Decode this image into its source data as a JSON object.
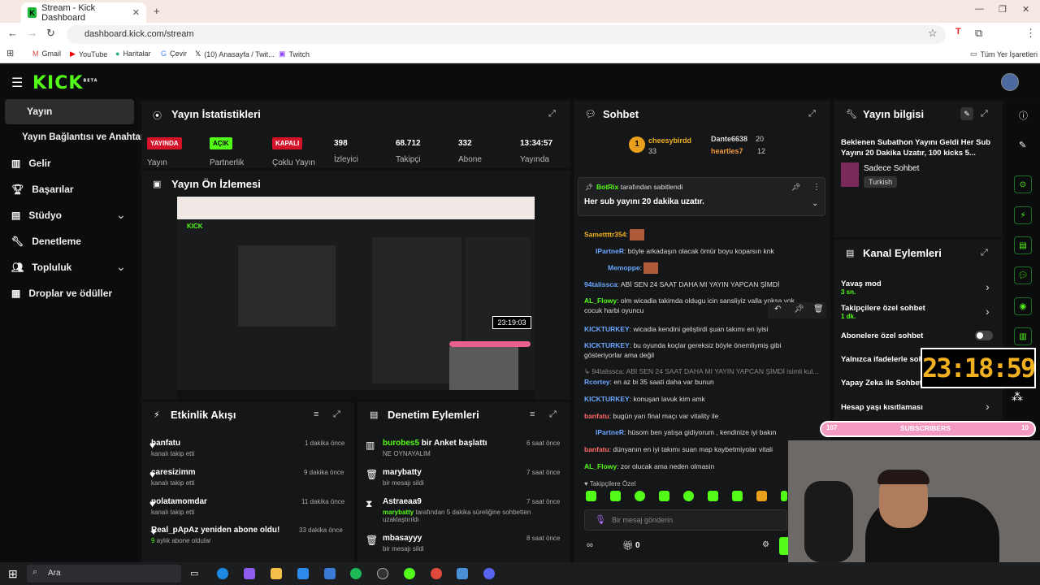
{
  "browser": {
    "tab_title": "Stream - Kick Dashboard",
    "url": "dashboard.kick.com/stream",
    "bookmarks": [
      "Gmail",
      "YouTube",
      "Haritalar",
      "Çevir",
      "(10) Anasayfa / Twit...",
      "Twitch"
    ],
    "all_bookmarks": "Tüm Yer İşaretleri"
  },
  "kick": {
    "logo": "KICK",
    "beta": "BETA"
  },
  "sidebar": {
    "items": [
      {
        "label": "Yayın"
      },
      {
        "label": "Yayın Bağlantısı ve Anahtarı"
      },
      {
        "label": "Gelir"
      },
      {
        "label": "Başarılar"
      },
      {
        "label": "Stüdyo"
      },
      {
        "label": "Denetleme"
      },
      {
        "label": "Topluluk"
      },
      {
        "label": "Droplar ve ödüller"
      }
    ]
  },
  "stats": {
    "title": "Yayın İstatistikleri",
    "live_badge": "YAYINDA",
    "live_label": "Yayın",
    "partner_badge": "AÇIK",
    "partner_label": "Partnerlik",
    "multi_badge": "KAPALI",
    "multi_label": "Çoklu Yayın",
    "viewers": "398",
    "viewers_label": "İzleyici",
    "followers": "68.712",
    "followers_label": "Takipçi",
    "subs": "332",
    "subs_label": "Abone",
    "uptime": "13:34:57",
    "uptime_label": "Yayında"
  },
  "preview": {
    "title": "Yayın Ön İzlemesi",
    "timer": "23:19:03"
  },
  "activity": {
    "title": "Etkinlik Akışı",
    "items": [
      {
        "name": "banfatu",
        "sub": "kanalı takip etti",
        "time": "1 dakika önce"
      },
      {
        "name": "caresizimm",
        "sub": "kanalı takip etti",
        "time": "9 dakika önce"
      },
      {
        "name": "polatamomdar",
        "sub": "kanalı takip etti",
        "time": "11 dakika önce"
      },
      {
        "name": "Real_pApAz yeniden abone oldu!",
        "sub_num": "9",
        "sub": " aylık abone oldular",
        "time": "33 dakika önce"
      }
    ]
  },
  "moderation": {
    "title": "Denetim Eylemleri",
    "items": [
      {
        "name": "burobes5",
        "action": " bir Anket başlattı",
        "sub": "NE OYNAYALIM",
        "time": "6 saat önce"
      },
      {
        "name": "marybatty",
        "sub": "bir mesajı sildi",
        "time": "7 saat önce"
      },
      {
        "name": "Astraeaa9",
        "sub_user": "marybatty",
        "sub": " tarafından 5 dakika süreliğine sohbetten uzaklaştırıldı",
        "time": "7 saat önce"
      },
      {
        "name": "mbasayyy",
        "sub": "bir mesajı sildi",
        "time": "8 saat önce"
      }
    ]
  },
  "chat": {
    "title": "Sohbet",
    "top": [
      {
        "name": "cheesybirdd",
        "count": "33"
      },
      {
        "name": "Dante6638",
        "count": "20"
      },
      {
        "name": "heartles7",
        "count": "12"
      }
    ],
    "rank": "1",
    "pinned_by": "BotRix",
    "pinned_suffix": " tarafından sabitlendi",
    "pinned_msg": "Her sub yayını 20 dakika uzatır.",
    "messages": [
      {
        "user": "Samettttr354",
        "text": ":",
        "color": "#f0b020"
      },
      {
        "user": "IPartneR",
        "text": ": böyle arkadaşın olacak ömür boyu koparsın knk",
        "color": "#6aa8ff"
      },
      {
        "user": "Memoppe",
        "text": ":",
        "color": "#6aa8ff"
      },
      {
        "user": "94talissca",
        "text": ": ABİ SEN 24 SAAT DAHA MI YAYIN YAPCAN ŞİMDİ",
        "color": "#6aa8ff"
      },
      {
        "user": "AL_Flowy",
        "text": ": olm wicadia takimda oldugu icin sansliyiz valla yoksa yok cocuk harbi oyuncu",
        "color": "#53fc18"
      },
      {
        "user": "KICKTURKEY",
        "text": ": wicadia kendini geliştirdi şuan takımı en iyisi",
        "color": "#6aa8ff"
      },
      {
        "user": "KICKTURKEY",
        "text": ": bu oyunda koçlar gereksiz böyle önemliymiş gibi gösteriyorlar ama değil",
        "color": "#6aa8ff"
      },
      {
        "user": "",
        "text": "94talissca: ABİ SEN 24 SAAT DAHA MI YAYIN YAPCAN ŞİMDİ isimli kul...",
        "color": "#888"
      },
      {
        "user": "Rcortey",
        "text": ": en az bi 35 saati daha var bunun",
        "color": "#6aa8ff"
      },
      {
        "user": "KICKTURKEY",
        "text": ": konuşan lavuk kim amk",
        "color": "#6aa8ff"
      },
      {
        "user": "banfatu",
        "text": ": bugün yarı final maçı var vitality ile",
        "color": "#ff6a6a"
      },
      {
        "user": "IPartneR",
        "text": ": hüsom ben yatışa gidiyorum , kendinize iyi bakın",
        "color": "#6aa8ff"
      },
      {
        "user": "banfatu",
        "text": ": dünyanın en iyi takımı suan map kaybetmiyolar vitali",
        "color": "#ff6a6a"
      },
      {
        "user": "AL_Flowy",
        "text": ": zor olucak ama neden olmasin",
        "color": "#53fc18"
      }
    ],
    "followers_only": "Takipçilere Özel",
    "input_placeholder": "Bir mesaj gönderin",
    "points": "0"
  },
  "stream_info": {
    "title": "Yayın bilgisi",
    "stream_title": "Beklenen Subathon Yayını Geldi Her Sub Yayını 20 Dakika Uzatır, 100 kicks 5...",
    "category": "Sadece Sohbet",
    "language": "Turkish"
  },
  "channel_actions": {
    "title": "Kanal Eylemleri",
    "slow_mode": "Yavaş mod",
    "slow_value": "3 sn.",
    "followers_chat": "Takipçilere özel sohbet",
    "followers_value": "1 dk.",
    "subs_chat": "Abonelere özel sohbet",
    "emotes_only": "Yalnızca ifadelerle sohbet",
    "ai_chat": "Yapay Zeka ile Sohbet Kontrolü",
    "age": "Hesap yaşı kısıtlaması"
  },
  "overlay": {
    "timer": "23:18:59",
    "subs_left": "107",
    "subs_label": "SUBSCRIBERS",
    "subs_right": "10"
  },
  "taskbar": {
    "search": "Ara"
  }
}
